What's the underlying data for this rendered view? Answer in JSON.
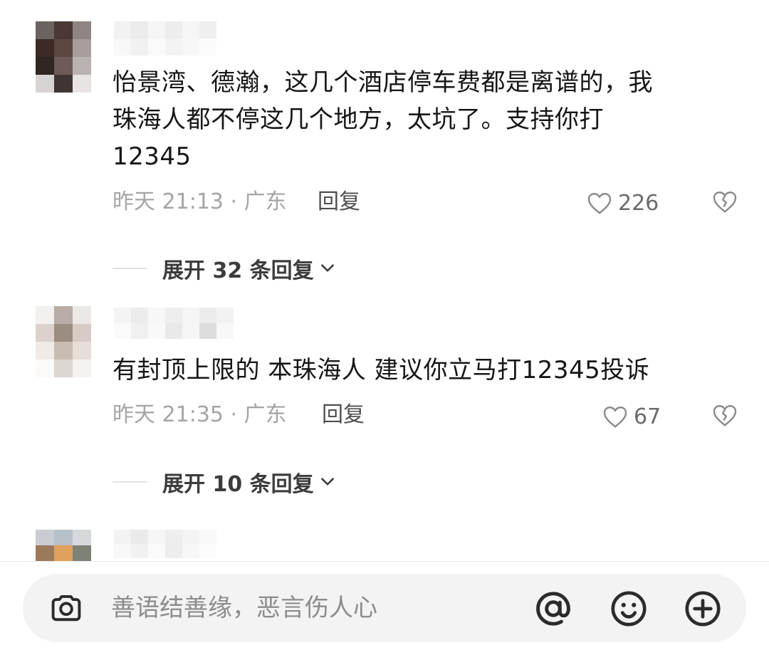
{
  "comments": [
    {
      "text": "怡景湾、德瀚，这几个酒店停车费都是离谱的，我珠海人都不停这几个地方，太坑了。支持你打12345",
      "text_lines": [
        "怡景湾、德瀚，这几个酒店停车费都是离谱的，我",
        "珠海人都不停这几个地方，太坑了。支持你打",
        "12345"
      ],
      "time_location": "昨天 21:13 · 广东",
      "reply_label": "回复",
      "likes": "226",
      "expand_label": "展开 32 条回复"
    },
    {
      "text": "有封顶上限的 本珠海人 建议你立马打12345投诉",
      "time_location": "昨天 21:35 · 广东",
      "reply_label": "回复",
      "likes": "67",
      "expand_label": "展开 10 条回复"
    }
  ],
  "input_bar": {
    "placeholder": "善语结善缘，恶言伤人心",
    "icons": [
      "camera-icon",
      "at-icon",
      "emoji-icon",
      "plus-icon"
    ]
  },
  "colors": {
    "text_primary": "#161616",
    "text_meta": "#a5a5a5",
    "input_bg": "#f3f3f4"
  }
}
